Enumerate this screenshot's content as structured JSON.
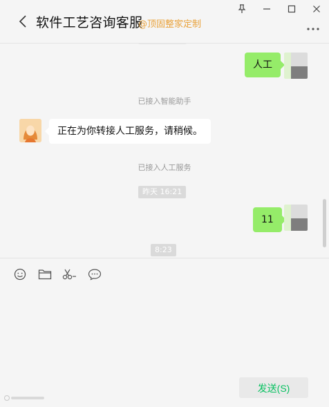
{
  "window": {
    "pin_icon": "pin-icon",
    "minimize_icon": "minimize-icon",
    "maximize_icon": "maximize-icon",
    "close_icon": "close-icon"
  },
  "header": {
    "title": "软件工艺咨询客服",
    "tag": "@顶固整家定制",
    "back_icon": "chevron-left-icon",
    "more_icon": "more-dots-icon"
  },
  "messages": [
    {
      "type": "outgoing",
      "text": "人工"
    },
    {
      "type": "system",
      "text": "已接入智能助手"
    },
    {
      "type": "incoming",
      "text": "正在为你转接人工服务，请稍候。"
    },
    {
      "type": "system",
      "text": "已接入人工服务"
    },
    {
      "type": "timestamp",
      "text": "昨天 16:21"
    },
    {
      "type": "outgoing",
      "text": "11"
    },
    {
      "type": "timestamp",
      "text": "8:23"
    }
  ],
  "toolbar": {
    "emoji_icon": "emoji-icon",
    "folder_icon": "folder-icon",
    "screenshot_icon": "scissors-icon",
    "chat_history_icon": "chat-bubble-icon"
  },
  "composer": {
    "input_value": "",
    "send_label": "发送(S)"
  },
  "colors": {
    "outgoing_bubble": "#95ec69",
    "incoming_bubble": "#ffffff",
    "send_text": "#07c160",
    "tag": "#e9a23b"
  }
}
